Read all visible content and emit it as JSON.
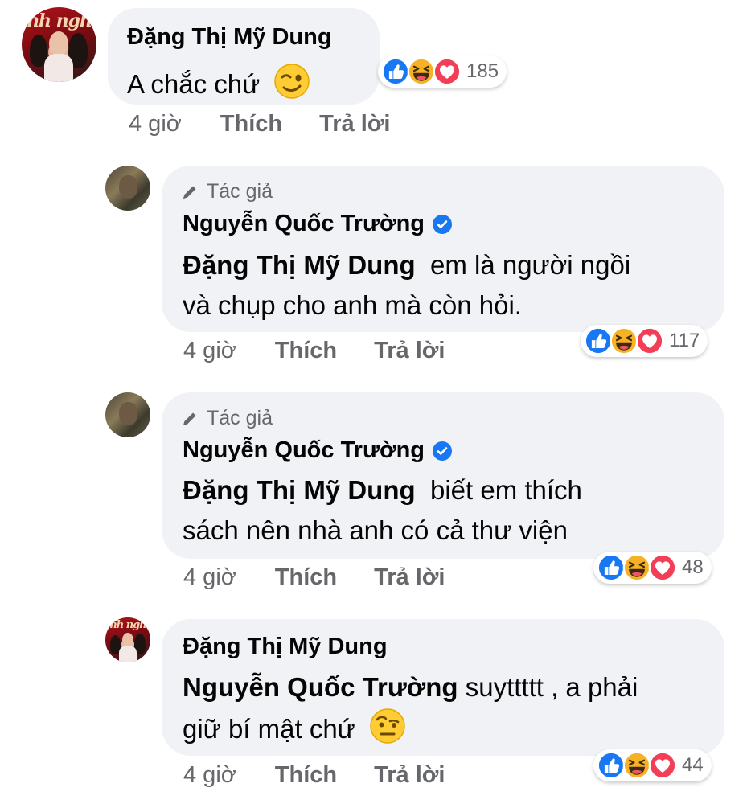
{
  "labels": {
    "author_tag": "Tác giả",
    "time": "4 giờ",
    "like": "Thích",
    "reply": "Trả lời"
  },
  "comments": [
    {
      "author": "Đặng Thị Mỹ Dung",
      "text": "A chắc chứ",
      "emoji": "wink-emoji",
      "reactions": {
        "icons": [
          "like-icon",
          "haha-icon",
          "love-icon"
        ],
        "count": "185"
      }
    },
    {
      "author_tag": true,
      "author": "Nguyễn Quốc Trường",
      "verified": true,
      "mention": "Đặng Thị Mỹ Dung",
      "text_line1": "em là người ngồi",
      "text_line2": "và chụp cho anh mà còn hỏi.",
      "reactions": {
        "icons": [
          "like-icon",
          "haha-icon",
          "love-icon"
        ],
        "count": "117"
      }
    },
    {
      "author_tag": true,
      "author": "Nguyễn Quốc Trường",
      "verified": true,
      "mention": "Đặng Thị Mỹ Dung",
      "text_line1": "biết em thích",
      "text_line2": "sách nên nhà anh có cả thư viện",
      "reactions": {
        "icons": [
          "like-icon",
          "haha-icon",
          "love-icon"
        ],
        "count": "48"
      }
    },
    {
      "author": "Đặng Thị Mỹ Dung",
      "mention": "Nguyễn Quốc Trường",
      "text_line1": "suyttttt , a phải",
      "text_line2": "giữ bí mật chứ",
      "emoji": "raised-eyebrow-emoji",
      "reactions": {
        "icons": [
          "like-icon",
          "haha-icon",
          "love-icon"
        ],
        "count": "44"
      }
    }
  ],
  "avatar_banner": "nh ngh",
  "colors": {
    "bubble": "#f0f2f5",
    "meta_text": "#65676b",
    "like_blue": "#1877f2",
    "love_red": "#f33e58",
    "haha_yellow": "#f7b125"
  }
}
